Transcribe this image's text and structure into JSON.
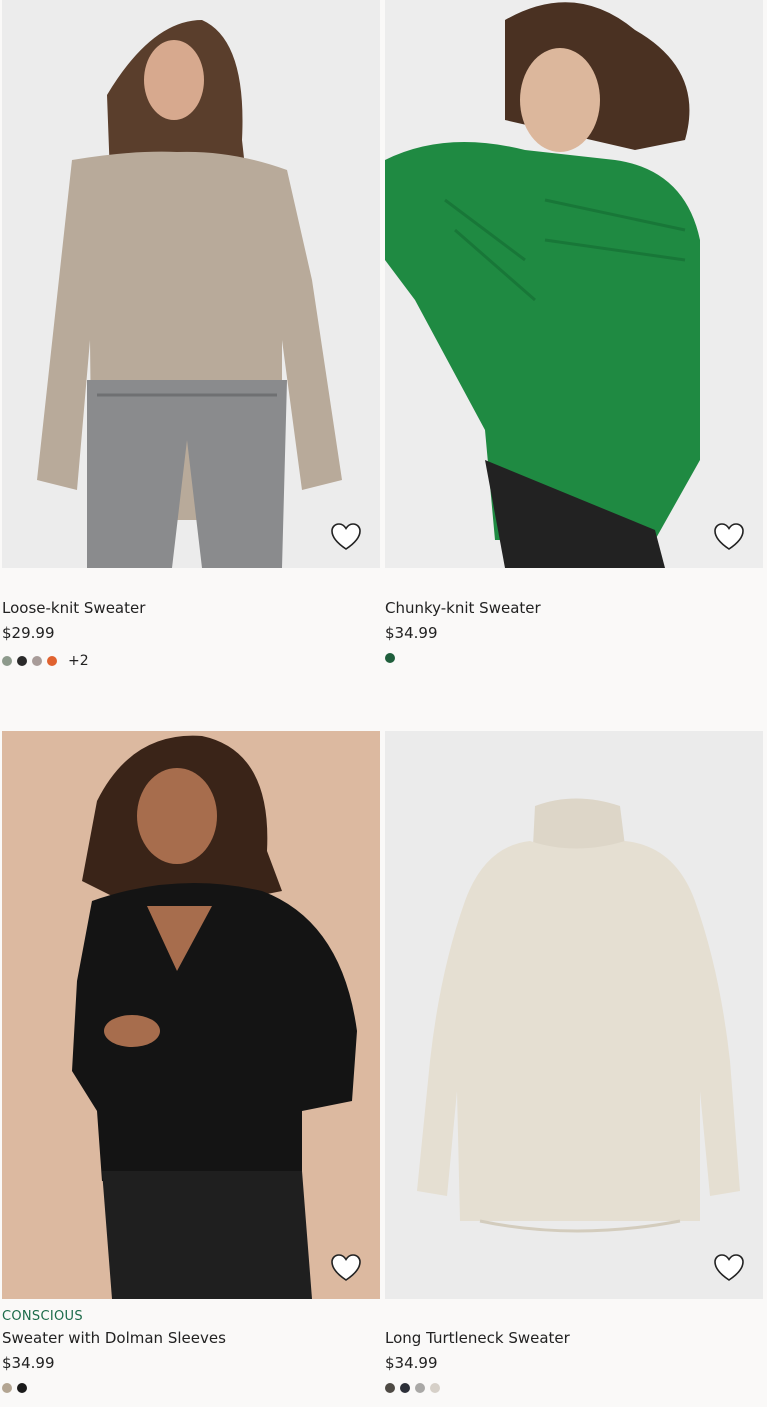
{
  "products": [
    {
      "title": "Loose-knit Sweater",
      "price": "$29.99",
      "tag": "",
      "swatches": [
        "#8d9a8c",
        "#2a2a2a",
        "#a89c99",
        "#e0622f"
      ],
      "more_colors": "+2",
      "bg": "#ececec",
      "garment": "#b8aa9a",
      "favorite_icon": "heart-outline-icon"
    },
    {
      "title": "Chunky-knit Sweater",
      "price": "$34.99",
      "tag": "",
      "swatches": [
        "#1f5e3c"
      ],
      "more_colors": "",
      "bg": "#ededed",
      "garment": "#1f8a42",
      "favorite_icon": "heart-outline-icon"
    },
    {
      "title": "Sweater with Dolman Sleeves",
      "price": "$34.99",
      "tag": "CONSCIOUS",
      "swatches": [
        "#b3a592",
        "#1a1a1a"
      ],
      "more_colors": "",
      "bg": "#dcb9a0",
      "garment": "#141414",
      "favorite_icon": "heart-outline-icon"
    },
    {
      "title": "Long Turtleneck Sweater",
      "price": "$34.99",
      "tag": "",
      "swatches": [
        "#4e4a44",
        "#2c2f38",
        "#a9a8a6",
        "#d6d0c8"
      ],
      "more_colors": "",
      "bg": "#ebebeb",
      "garment": "#e5dfd2",
      "favorite_icon": "heart-outline-icon"
    }
  ]
}
